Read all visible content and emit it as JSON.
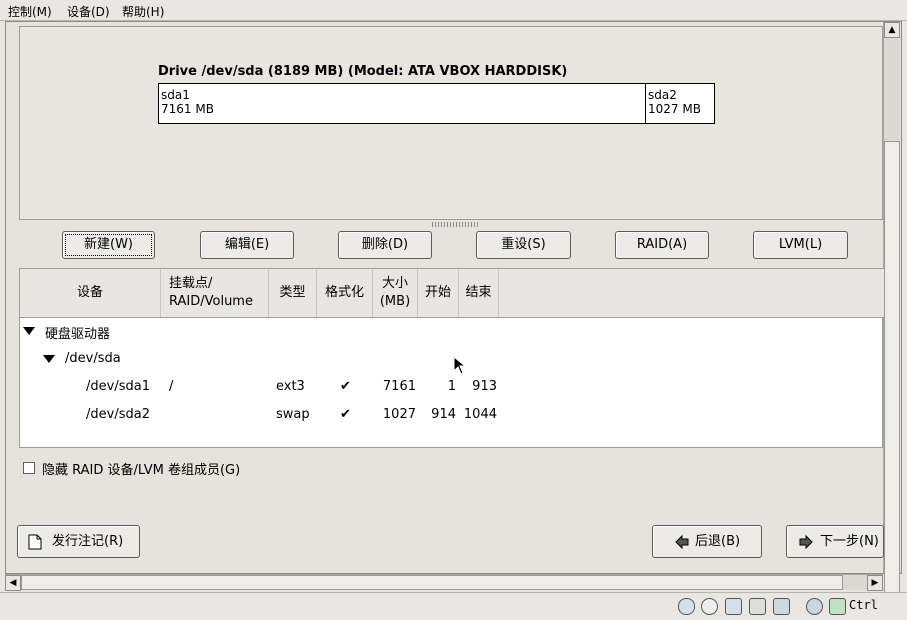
{
  "menu": {
    "control": "控制(M)",
    "devices": "设备(D)",
    "help": "帮助(H)"
  },
  "drive": {
    "title": "Drive /dev/sda (8189 MB) (Model: ATA VBOX HARDDISK)",
    "partitions": [
      {
        "name": "sda1",
        "size": "7161 MB"
      },
      {
        "name": "sda2",
        "size": "1027 MB"
      }
    ]
  },
  "actions": {
    "new": "新建(W)",
    "edit": "编辑(E)",
    "delete": "删除(D)",
    "reset": "重设(S)",
    "raid": "RAID(A)",
    "lvm": "LVM(L)"
  },
  "table": {
    "headers": {
      "device": "设备",
      "mount_1": "挂载点/",
      "mount_2": "RAID/Volume",
      "type": "类型",
      "format": "格式化",
      "size_1": "大小",
      "size_2": "(MB)",
      "start": "开始",
      "end": "结束"
    },
    "group": "硬盘驱动器",
    "disk": "/dev/sda",
    "rows": [
      {
        "device": "/dev/sda1",
        "mount": "/",
        "type": "ext3",
        "format": "✔",
        "size": "7161",
        "start": "1",
        "end": "913"
      },
      {
        "device": "/dev/sda2",
        "mount": "",
        "type": "swap",
        "format": "✔",
        "size": "1027",
        "start": "914",
        "end": "1044"
      }
    ]
  },
  "hide_raid_label": "隐藏 RAID 设备/LVM 卷组成员(G)",
  "bottom": {
    "release_notes": "发行注记(R)",
    "back": "后退(B)",
    "next": "下一步(N)"
  },
  "status": {
    "host_key": "Ctrl"
  }
}
